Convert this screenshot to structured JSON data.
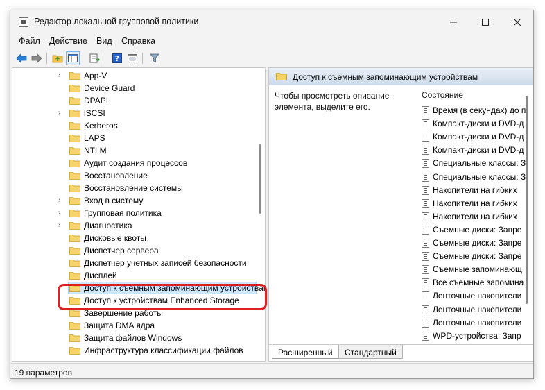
{
  "window": {
    "title": "Редактор локальной групповой политики",
    "controls": {
      "minimize": "—",
      "maximize": "☐",
      "close": "✕"
    }
  },
  "menu": [
    {
      "label": "Файл"
    },
    {
      "label": "Действие"
    },
    {
      "label": "Вид"
    },
    {
      "label": "Справка"
    }
  ],
  "toolbar": {
    "icons": [
      "back-arrow-icon",
      "forward-arrow-icon",
      "up-folder-icon",
      "show-hide-tree-icon",
      "export-list-icon",
      "help-icon",
      "properties-icon",
      "filter-icon"
    ]
  },
  "tree": {
    "items": [
      {
        "label": "App-V",
        "expandable": true
      },
      {
        "label": "Device Guard",
        "expandable": false
      },
      {
        "label": "DPAPI",
        "expandable": false
      },
      {
        "label": "iSCSI",
        "expandable": true
      },
      {
        "label": "Kerberos",
        "expandable": false
      },
      {
        "label": "LAPS",
        "expandable": false
      },
      {
        "label": "NTLM",
        "expandable": false
      },
      {
        "label": "Аудит создания процессов",
        "expandable": false
      },
      {
        "label": "Восстановление",
        "expandable": false
      },
      {
        "label": "Восстановление системы",
        "expandable": false
      },
      {
        "label": "Вход в систему",
        "expandable": true
      },
      {
        "label": "Групповая политика",
        "expandable": true
      },
      {
        "label": "Диагностика",
        "expandable": true
      },
      {
        "label": "Дисковые квоты",
        "expandable": false
      },
      {
        "label": "Диспетчер сервера",
        "expandable": false
      },
      {
        "label": "Диспетчер учетных записей безопасности",
        "expandable": false
      },
      {
        "label": "Дисплей",
        "expandable": false
      },
      {
        "label": "Доступ к съемным запоминающим устройствам",
        "expandable": false,
        "selected": true
      },
      {
        "label": "Доступ к устройствам Enhanced Storage",
        "expandable": false
      },
      {
        "label": "Завершение работы",
        "expandable": false
      },
      {
        "label": "Защита DMA ядра",
        "expandable": false
      },
      {
        "label": "Защита файлов Windows",
        "expandable": false
      },
      {
        "label": "Инфраструктура классификации файлов",
        "expandable": false
      }
    ]
  },
  "details": {
    "header": "Доступ к съемным запоминающим устройствам",
    "description": "Чтобы просмотреть описание элемента, выделите его.",
    "column_header": "Состояние",
    "settings": [
      "Время (в секундах) до п",
      "Компакт-диски и DVD-д",
      "Компакт-диски и DVD-д",
      "Компакт-диски и DVD-д",
      "Специальные классы: З",
      "Специальные классы: З",
      "Накопители на гибких",
      "Накопители на гибких",
      "Накопители на гибких",
      "Съемные диски: Запре",
      "Съемные диски: Запре",
      "Съемные диски: Запре",
      "Съемные запоминающ",
      "Все съемные запомина",
      "Ленточные накопители",
      "Ленточные накопители",
      "Ленточные накопители",
      "WPD-устройства: Запр"
    ],
    "tabs": [
      {
        "label": "Расширенный",
        "active": true
      },
      {
        "label": "Стандартный",
        "active": false
      }
    ]
  },
  "status": {
    "text": "19 параметров"
  }
}
